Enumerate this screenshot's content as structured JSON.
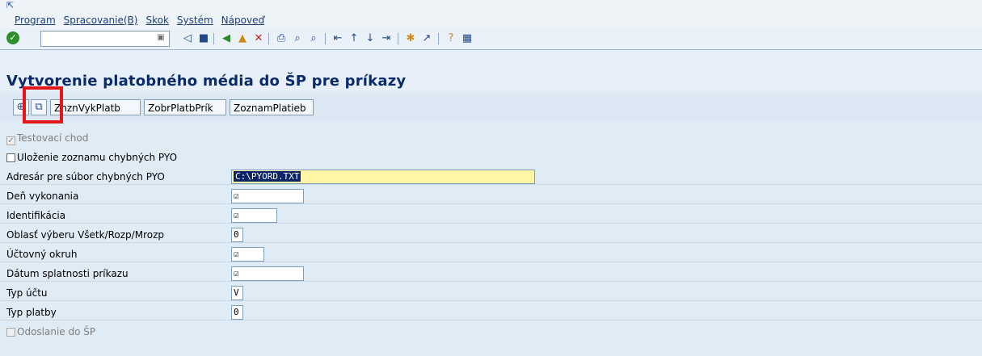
{
  "menubar": {
    "items": [
      "Program",
      "Spracovanie(B)",
      "Skok",
      "Systém",
      "Nápoveď"
    ]
  },
  "toolbar": {
    "icons": [
      "enter-check-icon",
      "back-icon",
      "save-icon",
      "back-nav-icon",
      "exit-icon",
      "cancel-icon",
      "print-icon",
      "find-icon",
      "find-next-icon",
      "first-page-icon",
      "prev-page-icon",
      "next-page-icon",
      "last-page-icon",
      "create-session-icon",
      "create-shortcut-icon",
      "help-icon",
      "layout-icon"
    ]
  },
  "page": {
    "title": "Vytvorenie platobného média do ŠP pre príkazy"
  },
  "appbar": {
    "buttons": [
      "ZnznVykPlatb",
      "ZobrPlatbPrík",
      "ZoznamPlatieb"
    ]
  },
  "form": {
    "testovaci_chod": "Testovací chod",
    "ulozenie": "Uloženie zoznamu chybných PYO",
    "adresar_label": "Adresár pre súbor chybných PYO",
    "adresar_value": "C:\\PYORD.TXT",
    "den_label": "Deň vykonania",
    "identifikacia_label": "Identifikácia",
    "oblast_label": "Oblasť výberu Všetk/Rozp/Mrozp",
    "oblast_value": "0",
    "uctovny_label": "Účtovný okruh",
    "datum_label": "Dátum splatnosti príkazu",
    "typ_uctu_label": "Typ účtu",
    "typ_uctu_value": "V",
    "typ_platby_label": "Typ platby",
    "typ_platby_value": "0",
    "odoslanie": "Odoslanie do ŠP",
    "check_glyph": "☑"
  }
}
